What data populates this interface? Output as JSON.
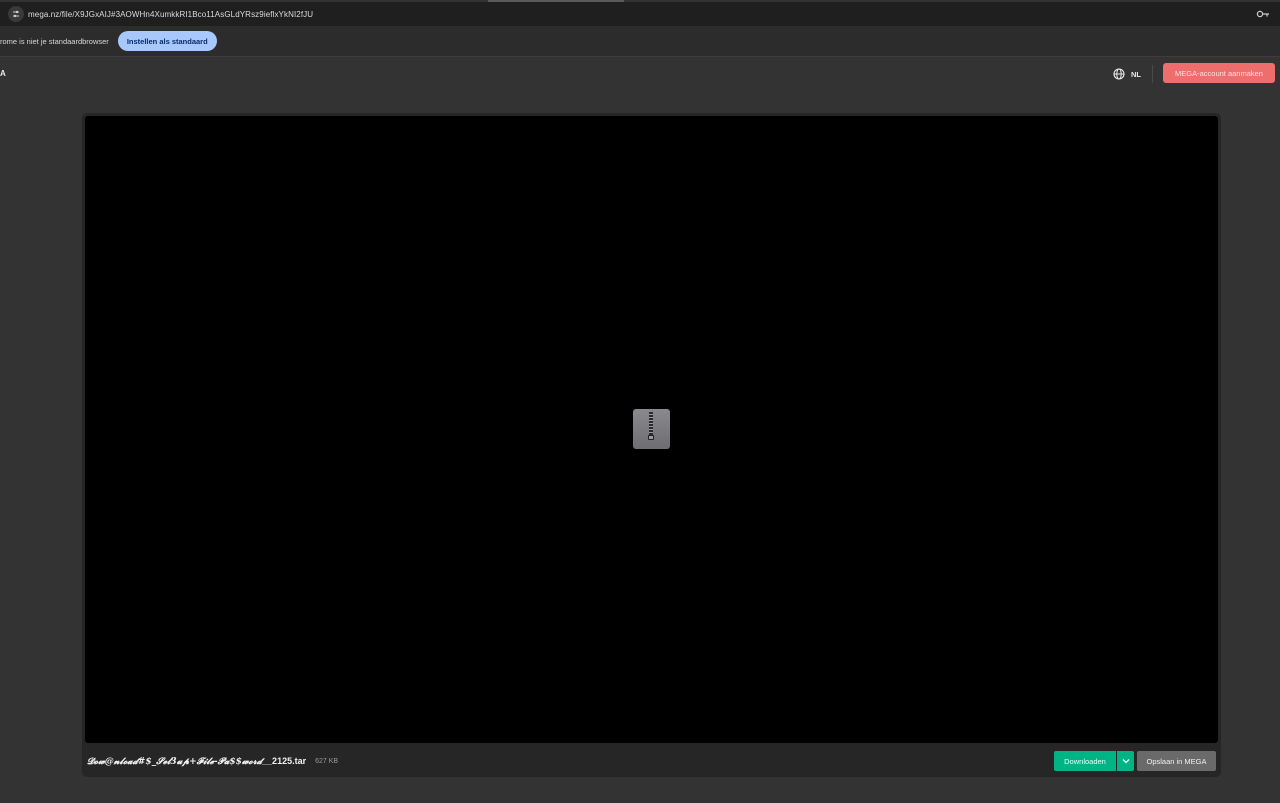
{
  "browser": {
    "url": "mega.nz/file/X9JGxAIJ#3AOWHn4XumkkRI1Bco11AsGLdYRsz9ieflxYkNI2fJU",
    "infobar_text": "rome is niet je standaardbrowser",
    "set_default_label": "Instellen als standaard"
  },
  "header": {
    "logo_fragment": "A",
    "language": "NL",
    "create_account_label": "MEGA-account aanmaken"
  },
  "file": {
    "name_styled": "𝓓𝓸𝔀@𝓷𝓵𝓸𝓪𝓭#$_𝓢𝓮𝓽3𝓾𝓹+𝓕𝓲𝓵𝓮-𝓟𝓪$$𝔀𝓸𝓻𝓭",
    "name_plain": "__2125.tar",
    "size": "627 KB",
    "icon": "zip-archive-icon"
  },
  "actions": {
    "download_label": "Downloaden",
    "save_label": "Opslaan in MEGA"
  },
  "colors": {
    "download": "#00b485",
    "create_account": "#ee6e6e",
    "set_default": "#a8c7fa"
  }
}
